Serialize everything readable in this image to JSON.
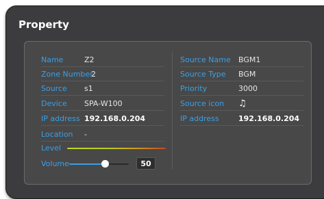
{
  "window": {
    "title": "Property"
  },
  "left": {
    "name": {
      "label": "Name",
      "value": "Z2"
    },
    "zone_number": {
      "label": "Zone Number",
      "value": "2"
    },
    "source": {
      "label": "Source",
      "value": "s1"
    },
    "device": {
      "label": "Device",
      "value": "SPA-W100"
    },
    "ip_address": {
      "label": "IP address",
      "value": "192.168.0.204"
    },
    "location": {
      "label": "Location",
      "value": "-"
    },
    "level": {
      "label": "Level"
    },
    "volume": {
      "label": "Volume",
      "value": "50",
      "level": 0.5
    }
  },
  "right": {
    "source_name": {
      "label": "Source Name",
      "value": "BGM1"
    },
    "source_type": {
      "label": "Source Type",
      "value": "BGM"
    },
    "priority": {
      "label": "Priority",
      "value": "3000"
    },
    "source_icon": {
      "label": "Source icon",
      "icon": "music-note-icon",
      "glyph": "♫"
    },
    "ip_address": {
      "label": "IP address",
      "value": "192.168.0.204"
    }
  },
  "colors": {
    "label": "#3aa0e8",
    "background": "#3c3c3e",
    "panel": "#484848"
  }
}
